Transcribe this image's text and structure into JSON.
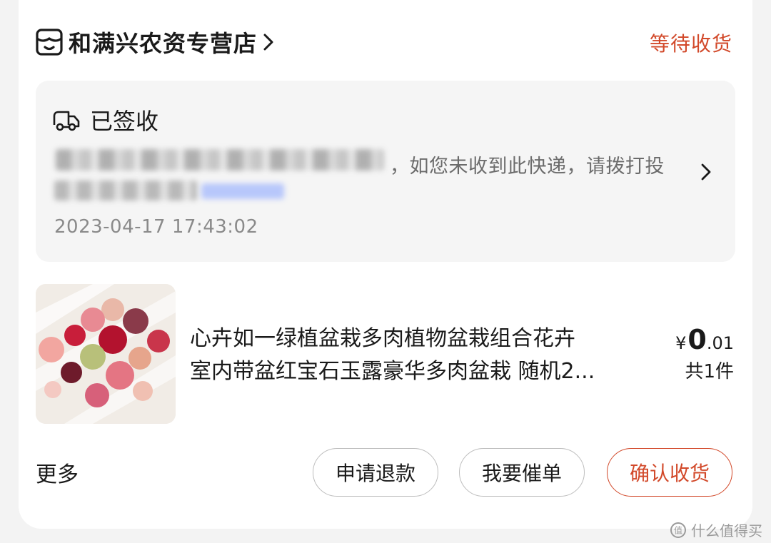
{
  "header": {
    "shop_name": "和满兴农资专营店",
    "order_status": "等待收货"
  },
  "logistics": {
    "status": "已签收",
    "message": "，如您未收到此快递，请拨打投",
    "time": "2023-04-17 17:43:02"
  },
  "product": {
    "title_line1": "心卉如一绿植盆栽多肉植物盆栽组合花卉",
    "title_line2": "室内带盆红宝石玉露豪华多肉盆栽 随机2...",
    "price_currency": "¥",
    "price_int": "0",
    "price_dec": ".01",
    "quantity": "共1件"
  },
  "footer": {
    "more_label": "更多",
    "refund_label": "申请退款",
    "urge_label": "我要催单",
    "confirm_label": "确认收货"
  },
  "watermark": {
    "text": "什么值得买"
  },
  "colors": {
    "accent": "#d2492a",
    "background": "#f3f3f3",
    "card": "#ffffff",
    "panel": "#f5f5f5"
  }
}
